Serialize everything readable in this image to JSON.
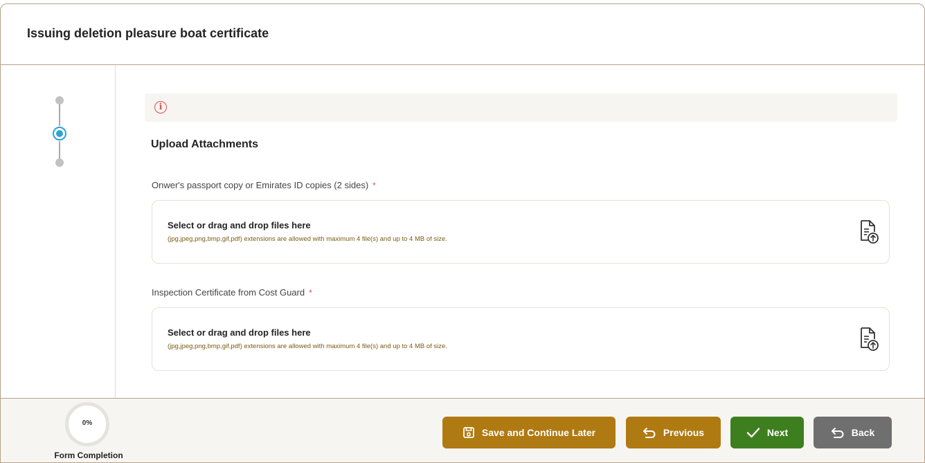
{
  "header": {
    "title": "Issuing deletion pleasure boat certificate"
  },
  "alert": {
    "icon": "info-icon",
    "symbol": "i"
  },
  "section": {
    "title": "Upload Attachments"
  },
  "fields": [
    {
      "label": "Onwer's passport copy or Emirates ID copies (2 sides)",
      "required_mark": "*",
      "dropzone_title": "Select or drag and drop files here",
      "dropzone_hint": "(jpg,jpeg,png,bmp,gif,pdf) extensions are allowed with maximum 4 file(s) and up to 4 MB of size."
    },
    {
      "label": "Inspection Certificate from Cost Guard",
      "required_mark": "*",
      "dropzone_title": "Select or drag and drop files here",
      "dropzone_hint": "(jpg,jpeg,png,bmp,gif,pdf) extensions are allowed with maximum 4 file(s) and up to 4 MB of size."
    }
  ],
  "footer": {
    "progress_value": "0%",
    "progress_label": "Form Completion",
    "save_label": "Save and Continue Later",
    "previous_label": "Previous",
    "next_label": "Next",
    "back_label": "Back"
  },
  "colors": {
    "brand_gold": "#b07a12",
    "next_green": "#3d7f1f",
    "back_grey": "#6f6f6f",
    "step_active": "#2aa3dc",
    "required_red": "#e14b4b"
  }
}
